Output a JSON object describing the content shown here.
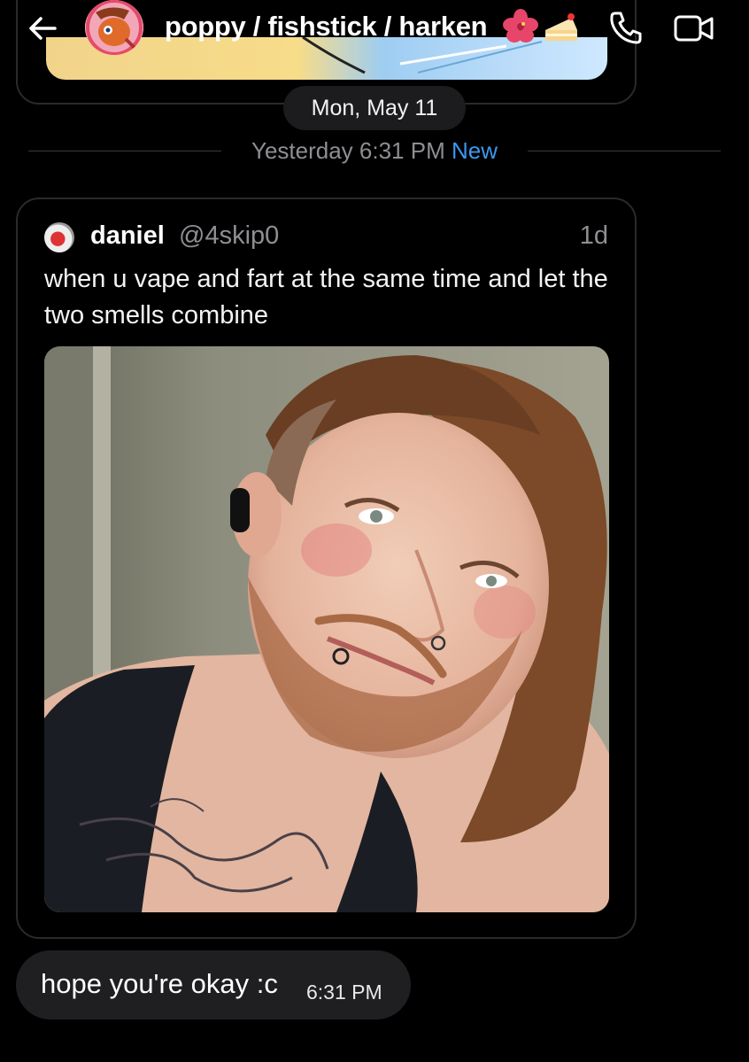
{
  "header": {
    "title": "poppy / fishstick / harken",
    "emojis": [
      "hibiscus",
      "cake-slice"
    ],
    "back_icon": "arrow-left-icon",
    "call_icon": "phone-icon",
    "video_icon": "video-camera-icon"
  },
  "date_pill": "Mon, May 11",
  "new_divider": {
    "time": "Yesterday 6:31 PM",
    "badge": "New"
  },
  "shared_post": {
    "author_name": "daniel",
    "author_handle": "@4skip0",
    "age": "1d",
    "text": "when u vape and fart at the same time and let the two smells combine",
    "image": "selfie-photo"
  },
  "message": {
    "text": "hope you're okay :c",
    "time": "6:31 PM"
  },
  "colors": {
    "background": "#000000",
    "accent": "#3b98f0",
    "bubble": "#1f1f22",
    "muted": "#8e8e93"
  }
}
